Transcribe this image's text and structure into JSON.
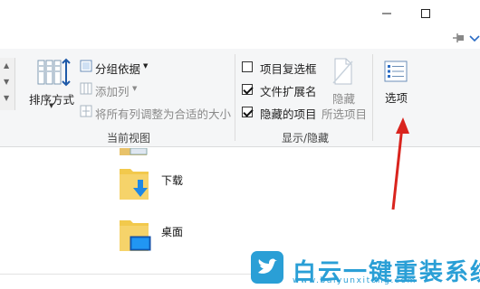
{
  "window": {
    "minimize_icon": "minimize-icon",
    "maximize_icon": "maximize-icon",
    "pin_icon": "pin-icon",
    "expand_icon": "chevron-down-icon"
  },
  "ribbon": {
    "current_view": {
      "group_label": "当前视图",
      "sort_label": "排序方式",
      "group_by_label": "分组依据",
      "add_column_label": "添加列",
      "fit_columns_label": "将所有列调整为合适的大小"
    },
    "show_hide": {
      "group_label": "显示/隐藏",
      "item_checkboxes": {
        "label": "项目复选框",
        "checked": false
      },
      "file_extensions": {
        "label": "文件扩展名",
        "checked": true
      },
      "hidden_items": {
        "label": "隐藏的项目",
        "checked": true
      },
      "hide_selected_line1": "隐藏",
      "hide_selected_line2": "所选项目"
    },
    "options_label": "选项"
  },
  "folders": [
    {
      "name": "下载",
      "icon": "download-folder-icon"
    },
    {
      "name": "桌面",
      "icon": "desktop-folder-icon"
    }
  ],
  "watermark": {
    "text": "白云一键重装系统",
    "url": "www.baiyunxitong.com",
    "icon": "twitter-bird-icon",
    "color": "#2a9fd6"
  },
  "annotation": {
    "color": "#d9241e"
  }
}
